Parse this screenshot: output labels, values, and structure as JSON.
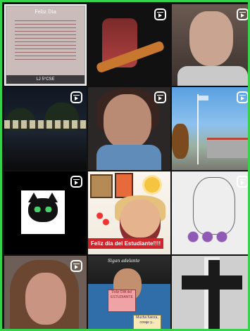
{
  "tiles": [
    {
      "name": "tile-greeting-card",
      "reel": false,
      "title": "Feliz Dia",
      "footer": "LJ 5°CSE"
    },
    {
      "name": "tile-guitar-player",
      "reel": true
    },
    {
      "name": "tile-man-closeup",
      "reel": true
    },
    {
      "name": "tile-school-building-night",
      "reel": true
    },
    {
      "name": "tile-girl-blue-shirt",
      "reel": true
    },
    {
      "name": "tile-school-flagpole",
      "reel": true
    },
    {
      "name": "tile-black-cat-drawing",
      "reel": true
    },
    {
      "name": "tile-teacher-message",
      "reel": false,
      "banner": "Feliz día del Estudiante!!!!"
    },
    {
      "name": "tile-sketch-flowers",
      "reel": true
    },
    {
      "name": "tile-woman-portrait",
      "reel": true
    },
    {
      "name": "tile-man-holding-signs",
      "reel": false,
      "wall_text": "Sigan adelante",
      "sign1": "Feliz DÍA del ESTUDIANTE",
      "sign2": "Mucha fuerza, coraje y..."
    },
    {
      "name": "tile-cross",
      "reel": false
    }
  ],
  "colors": {
    "frame_border": "#36d24a",
    "banner": "#d0242a",
    "reel_icon": "#ffffff"
  },
  "icons": {
    "reel": "reel-icon"
  }
}
